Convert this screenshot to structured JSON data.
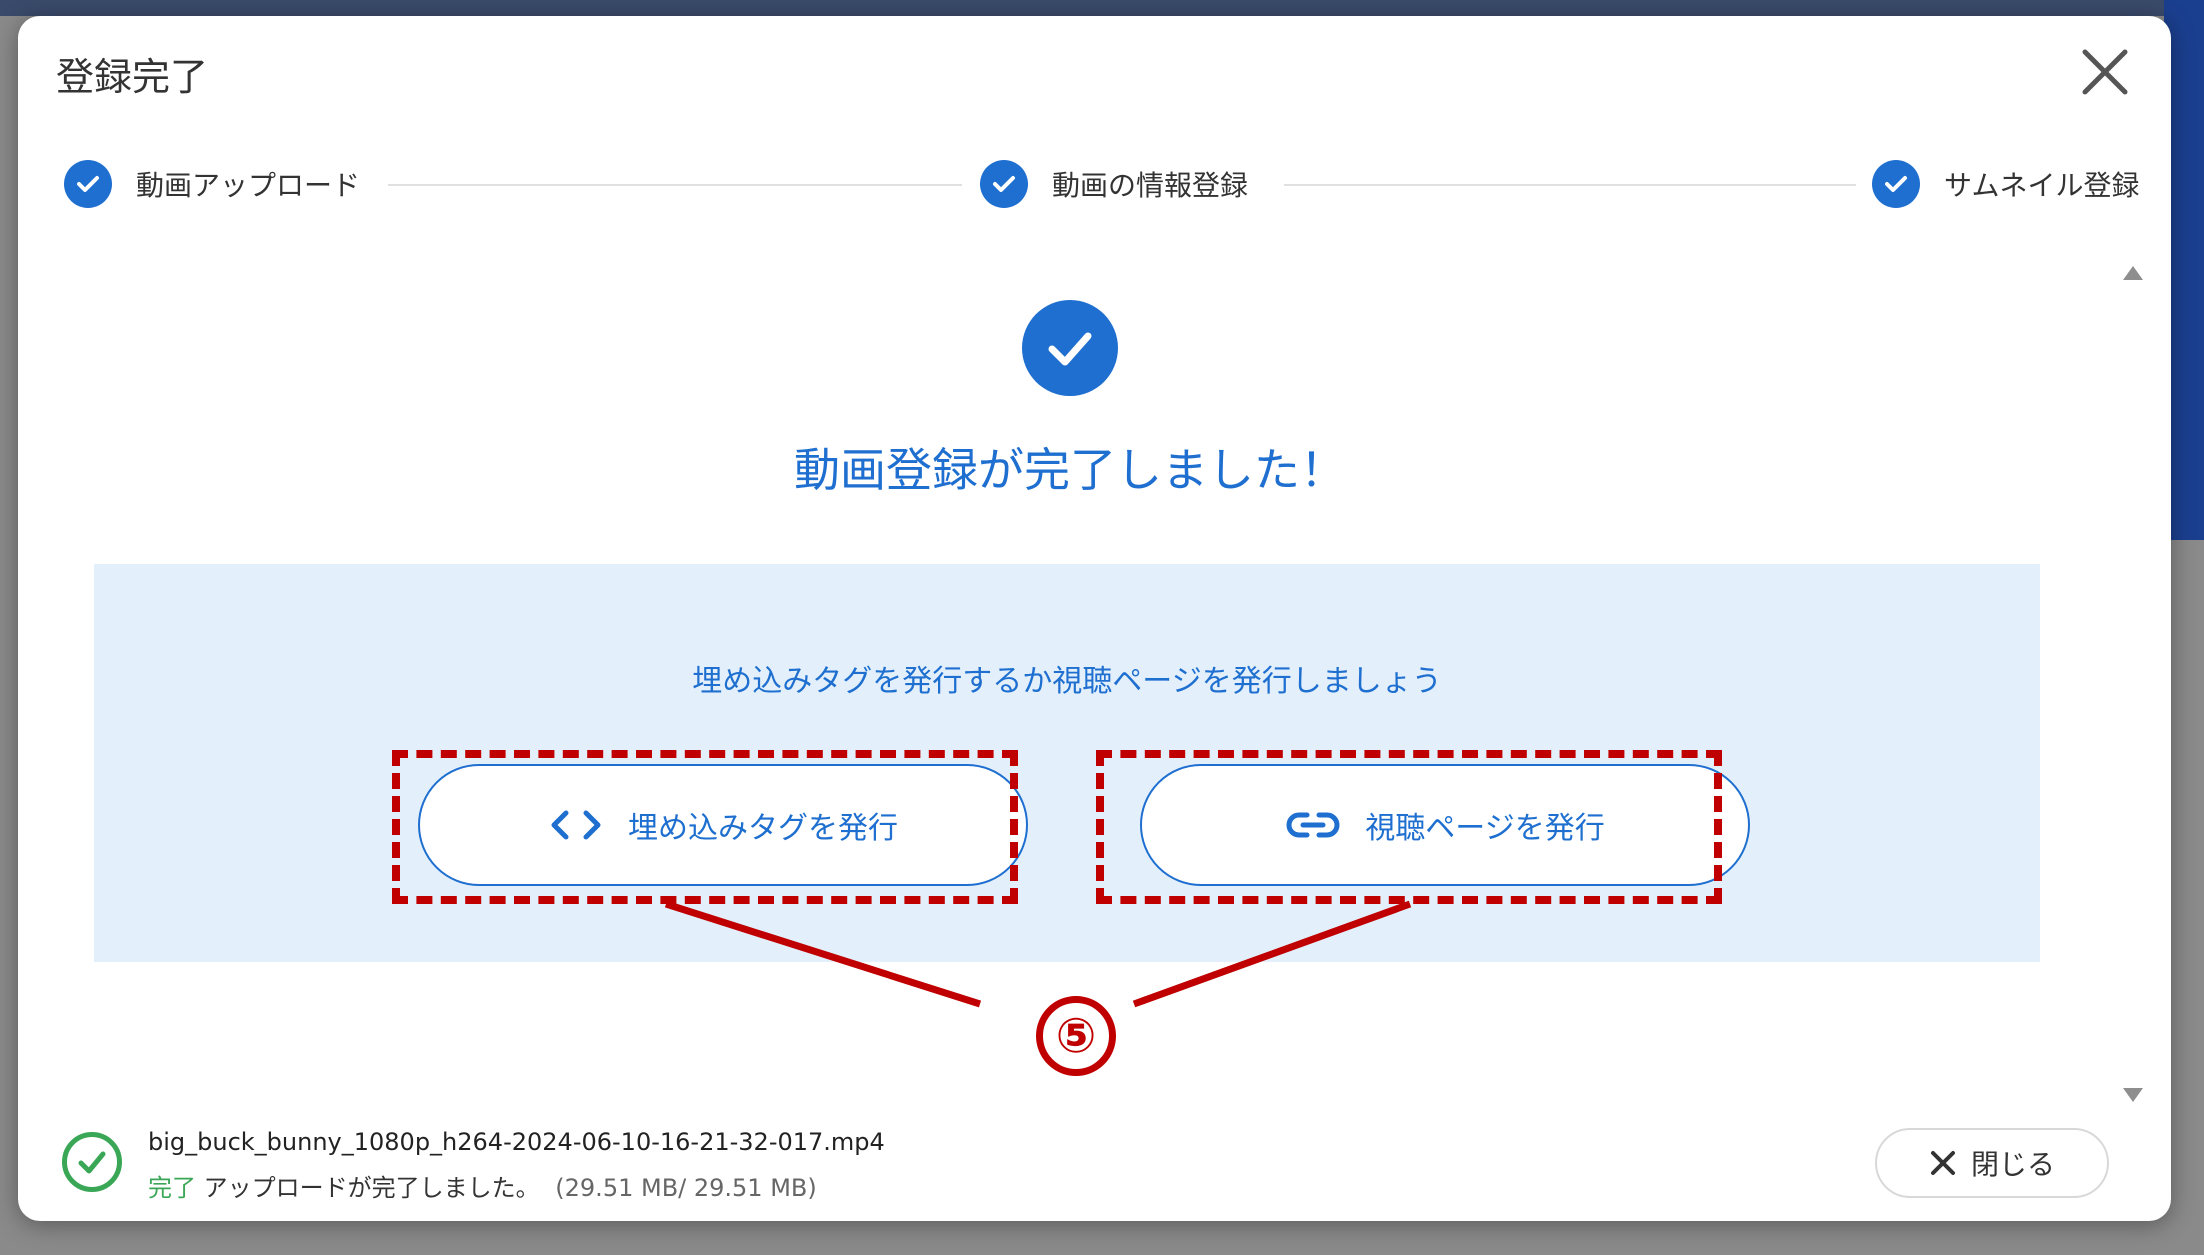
{
  "dialog": {
    "title": "登録完了"
  },
  "stepper": {
    "steps": [
      {
        "label": "動画アップロード",
        "status": "done"
      },
      {
        "label": "動画の情報登録",
        "status": "done"
      },
      {
        "label": "サムネイル登録",
        "status": "done"
      }
    ]
  },
  "main": {
    "success_message": "動画登録が完了しました！",
    "panel_text": "埋め込みタグを発行するか視聴ページを発行しましょう",
    "embed_button_label": "埋め込みタグを発行",
    "view_page_button_label": "視聴ページを発行"
  },
  "annotation": {
    "callout_number": "⑤",
    "color": "#c00000"
  },
  "footer": {
    "file_name": "big_buck_bunny_1080p_h264-2024-06-10-16-21-32-017.mp4",
    "status_word": "完了",
    "status_text": "アップロードが完了しました。",
    "size_text": "(29.51 MB/ 29.51 MB)",
    "close_label": "閉じる"
  },
  "colors": {
    "accent": "#1e6fd0",
    "success": "#3aa757",
    "panel_bg": "#e3f0fb"
  }
}
